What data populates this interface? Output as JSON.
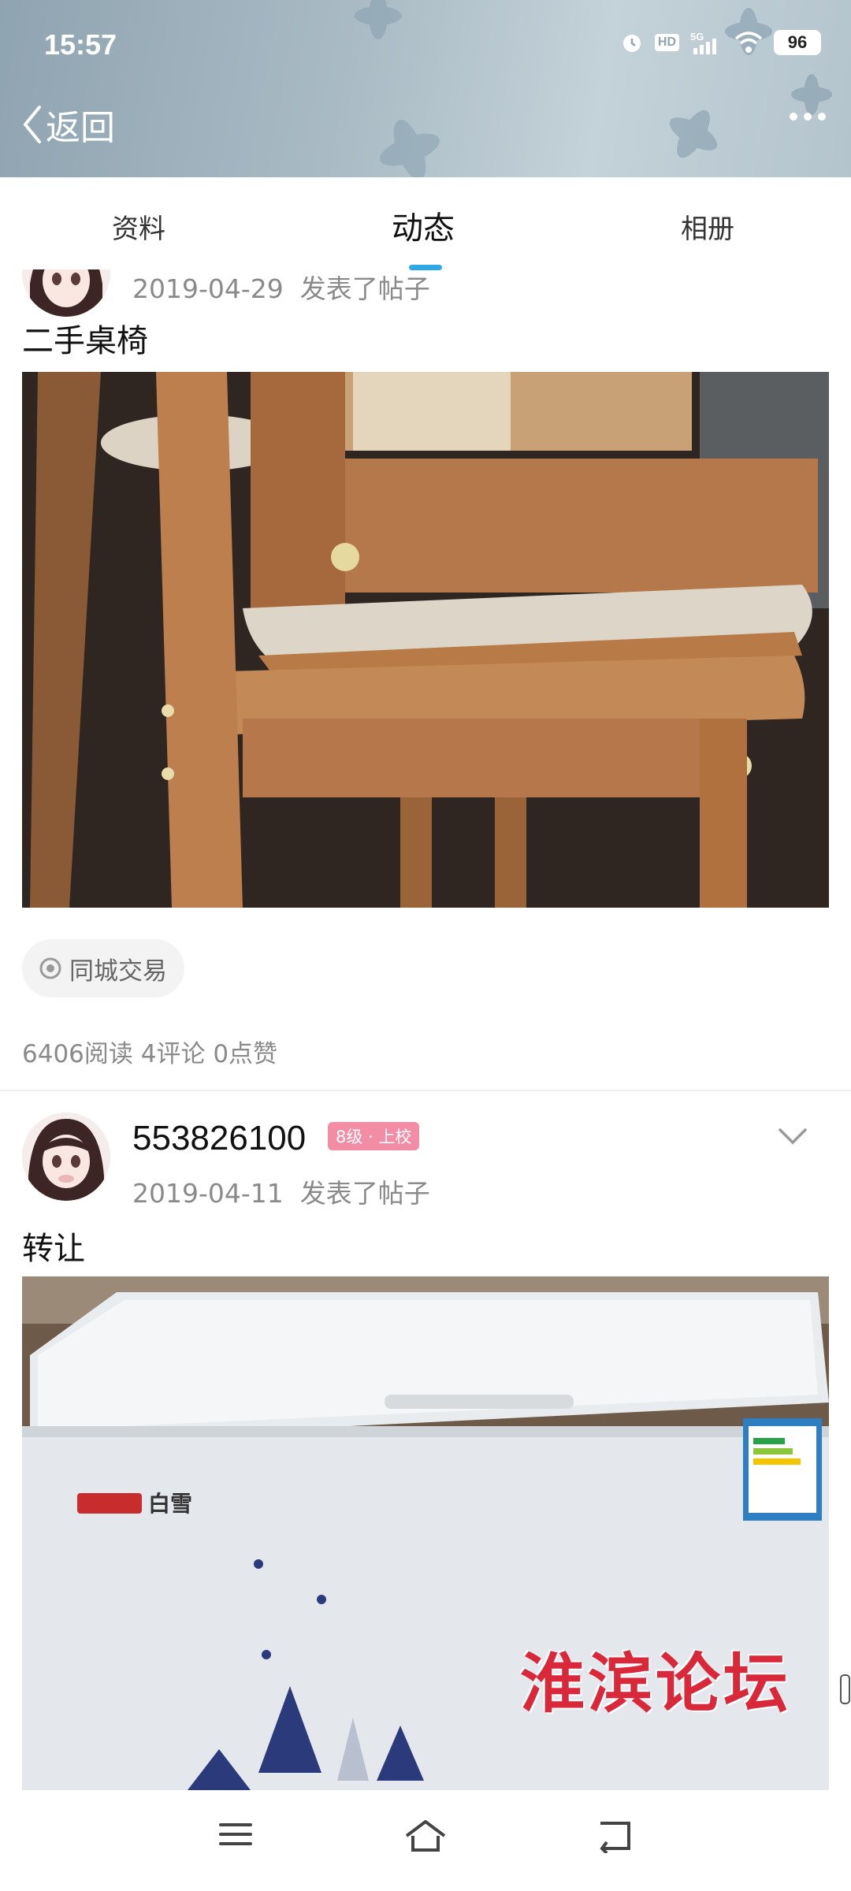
{
  "status_bar": {
    "time": "15:57",
    "hd_label": "HD",
    "network_label": "5G",
    "battery": "96",
    "icons": [
      "alarm-icon",
      "hd-icon",
      "signal-icon",
      "wifi-icon",
      "battery-icon"
    ]
  },
  "header": {
    "back_label": "返回",
    "more_icon": "more-icon"
  },
  "tabs": [
    {
      "label": "资料",
      "active": false
    },
    {
      "label": "动态",
      "active": true
    },
    {
      "label": "相册",
      "active": false
    }
  ],
  "posts": [
    {
      "date": "2019-04-29",
      "action": "发表了帖子",
      "title": "二手桌椅",
      "tag": "同城交易",
      "stats": "6406阅读 4评论 0点赞"
    },
    {
      "username": "553826100",
      "level": "8级 · 上校",
      "date": "2019-04-11",
      "action": "发表了帖子",
      "title": "转让"
    }
  ],
  "image_text": {
    "freezer_brand": "白雪"
  },
  "watermark": "淮滨论坛",
  "navbar": {
    "icons": [
      "menu-icon",
      "home-icon",
      "back-icon"
    ]
  },
  "colors": {
    "accent": "#2fa8e6",
    "level_badge": "#f28da5",
    "watermark": "#d8283a"
  }
}
